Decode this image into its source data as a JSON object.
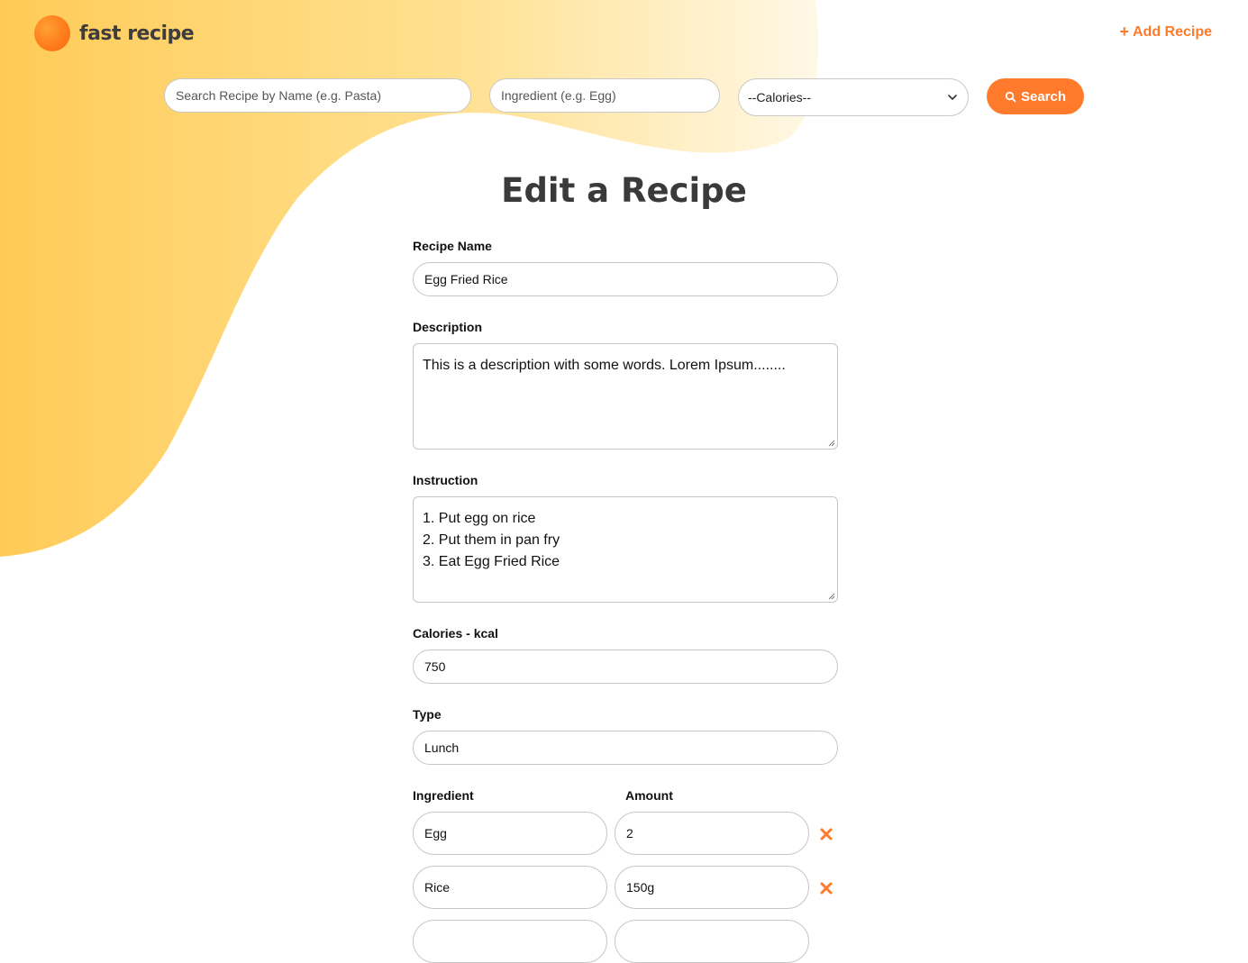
{
  "brand": {
    "name": "fast recipe"
  },
  "header": {
    "add_recipe_label": "Add Recipe"
  },
  "search": {
    "name_placeholder": "Search Recipe by Name (e.g. Pasta)",
    "ingredient_placeholder": "Ingredient (e.g. Egg)",
    "calories_selected": "--Calories--",
    "search_label": "Search"
  },
  "form": {
    "title": "Edit a Recipe",
    "recipe_name": {
      "label": "Recipe Name",
      "value": "Egg Fried Rice"
    },
    "description": {
      "label": "Description",
      "value": "This is a description with some words. Lorem Ipsum........"
    },
    "instruction": {
      "label": "Instruction",
      "lines": [
        "1. Put egg on rice",
        "2. Put them in pan fry",
        "3. Eat Egg Fried Rice"
      ]
    },
    "calories": {
      "label": "Calories - kcal",
      "value": "750"
    },
    "type": {
      "label": "Type",
      "value": "Lunch"
    },
    "ingredients": {
      "ingredient_label": "Ingredient",
      "amount_label": "Amount",
      "rows": [
        {
          "ingredient": "Egg",
          "amount": "2"
        },
        {
          "ingredient": "Rice",
          "amount": "150g"
        }
      ]
    }
  },
  "colors": {
    "accent": "#ff7a2b",
    "blob_start": "#ffcb57",
    "blob_end": "#fff6dc"
  }
}
